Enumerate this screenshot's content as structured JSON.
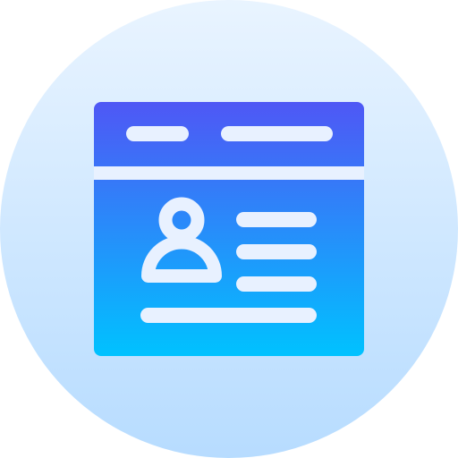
{
  "icon": {
    "name": "web-profile-card-icon",
    "elements": [
      "circle-background",
      "window-frame",
      "title-bar",
      "avatar-icon",
      "detail-lines"
    ]
  },
  "colors": {
    "circle_top": "#e9f4ff",
    "circle_bottom": "#b7dcff",
    "window_top": "#4f57f5",
    "window_bottom": "#00c2ff",
    "foreground": "#e8f1ff"
  }
}
